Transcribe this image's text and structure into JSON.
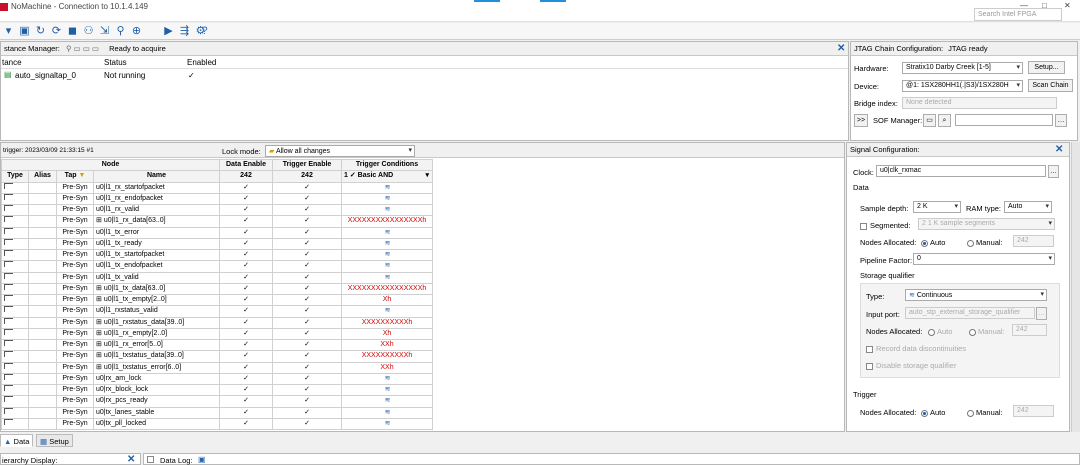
{
  "window": {
    "title": "NoMachine - Connection to 10.1.4.149",
    "search_placeholder": "Search Intel FPGA",
    "min": "—",
    "max": "□",
    "close": "✕"
  },
  "instance_manager": {
    "title": "stance Manager:",
    "status": "Ready to acquire",
    "columns": [
      "tance",
      "Status",
      "Enabled"
    ],
    "row": {
      "name": "auto_signaltap_0",
      "status": "Not running",
      "enabled": "✓"
    }
  },
  "jtag": {
    "title": "JTAG Chain Configuration:",
    "status": "JTAG ready",
    "hardware_label": "Hardware:",
    "hardware_value": "Stratix10 Darby Creek [1-5]",
    "setup_label": "Setup...",
    "device_label": "Device:",
    "device_value": "@1: 1SX280HH1(.|S3)/1SX280H",
    "scan_label": "Scan Chain",
    "bridge_label": "Bridge index:",
    "bridge_value": "None detected",
    "sof_button": ">>",
    "sof_label": "SOF Manager:"
  },
  "node_list": {
    "trigger_info": "trigger: 2023/03/09 21:33:15  #1",
    "lock_label": "Lock mode:",
    "lock_value": "Allow all changes",
    "group_node": "Node",
    "group_data": "Data Enable",
    "group_trigger": "Trigger Enable",
    "group_cond": "Trigger Conditions",
    "cols": [
      "Type",
      "Alias",
      "Tap",
      "Name"
    ],
    "data_count": "242",
    "trig_count": "242",
    "cond_value": "1 ✓ Basic AND",
    "rows": [
      {
        "tap": "Pre-Syn",
        "name": "u0|l1_rx_startofpacket",
        "exp": "",
        "cond": "≋",
        "red": false
      },
      {
        "tap": "Pre-Syn",
        "name": "u0|l1_rx_endofpacket",
        "exp": "",
        "cond": "≋",
        "red": false
      },
      {
        "tap": "Pre-Syn",
        "name": "u0|l1_rx_valid",
        "exp": "",
        "cond": "≋",
        "red": false
      },
      {
        "tap": "Pre-Syn",
        "name": "u0|l1_rx_data[63..0]",
        "exp": "⊞",
        "cond": "XXXXXXXXXXXXXXXXh",
        "red": true
      },
      {
        "tap": "Pre-Syn",
        "name": "u0|l1_tx_error",
        "exp": "",
        "cond": "≋",
        "red": false
      },
      {
        "tap": "Pre-Syn",
        "name": "u0|l1_tx_ready",
        "exp": "",
        "cond": "≋",
        "red": false
      },
      {
        "tap": "Pre-Syn",
        "name": "u0|l1_tx_startofpacket",
        "exp": "",
        "cond": "≋",
        "red": false
      },
      {
        "tap": "Pre-Syn",
        "name": "u0|l1_tx_endofpacket",
        "exp": "",
        "cond": "≋",
        "red": false
      },
      {
        "tap": "Pre-Syn",
        "name": "u0|l1_tx_valid",
        "exp": "",
        "cond": "≋",
        "red": false
      },
      {
        "tap": "Pre-Syn",
        "name": "u0|l1_tx_data[63..0]",
        "exp": "⊞",
        "cond": "XXXXXXXXXXXXXXXXh",
        "red": true
      },
      {
        "tap": "Pre-Syn",
        "name": "u0|l1_tx_empty[2..0]",
        "exp": "⊞",
        "cond": "Xh",
        "red": true
      },
      {
        "tap": "Pre-Syn",
        "name": "u0|l1_rxstatus_valid",
        "exp": "",
        "cond": "≋",
        "red": false
      },
      {
        "tap": "Pre-Syn",
        "name": "u0|l1_rxstatus_data[39..0]",
        "exp": "⊞",
        "cond": "XXXXXXXXXXh",
        "red": true
      },
      {
        "tap": "Pre-Syn",
        "name": "u0|l1_rx_empty[2..0]",
        "exp": "⊞",
        "cond": "Xh",
        "red": true
      },
      {
        "tap": "Pre-Syn",
        "name": "u0|l1_rx_error[5..0]",
        "exp": "⊞",
        "cond": "XXh",
        "red": true
      },
      {
        "tap": "Pre-Syn",
        "name": "u0|l1_txstatus_data[39..0]",
        "exp": "⊞",
        "cond": "XXXXXXXXXXh",
        "red": true
      },
      {
        "tap": "Pre-Syn",
        "name": "u0|l1_txstatus_error[6..0]",
        "exp": "⊞",
        "cond": "XXh",
        "red": true
      },
      {
        "tap": "Pre-Syn",
        "name": "u0|rx_am_lock",
        "exp": "",
        "cond": "≋",
        "red": false
      },
      {
        "tap": "Pre-Syn",
        "name": "u0|rx_block_lock",
        "exp": "",
        "cond": "≋",
        "red": false
      },
      {
        "tap": "Pre-Syn",
        "name": "u0|rx_pcs_ready",
        "exp": "",
        "cond": "≋",
        "red": false
      },
      {
        "tap": "Pre-Syn",
        "name": "u0|tx_lanes_stable",
        "exp": "",
        "cond": "≋",
        "red": false
      },
      {
        "tap": "Pre-Syn",
        "name": "u0|tx_pll_locked",
        "exp": "",
        "cond": "≋",
        "red": false
      }
    ],
    "check": "✓"
  },
  "signal_config": {
    "title": "Signal Configuration:",
    "clock_label": "Clock:",
    "clock_value": "u0|clk_rxmac",
    "data_section": "Data",
    "depth_label": "Sample depth:",
    "depth_value": "2 K",
    "ram_label": "RAM type:",
    "ram_value": "Auto",
    "segmented_label": "Segmented:",
    "segmented_value": "2  1 K sample segments",
    "nodes_alloc_label": "Nodes Allocated:",
    "auto_label": "Auto",
    "manual_label": "Manual:",
    "manual_value": "242",
    "pipeline_label": "Pipeline Factor:",
    "pipeline_value": "0",
    "storage_section": "Storage qualifier",
    "type_label": "Type:",
    "type_value": "Continuous",
    "input_port_label": "Input port:",
    "input_port_value": "auto_stp_external_storage_qualifier",
    "sq_nodes_label": "Nodes Allocated:",
    "sq_auto": "Auto",
    "sq_manual": "Manual:",
    "sq_manual_value": "242",
    "record_label": "Record data discontinuities",
    "disable_label": "Disable storage qualifier",
    "trigger_section": "Trigger",
    "trig_nodes_label": "Nodes Allocated:",
    "trig_auto": "Auto",
    "trig_manual": "Manual:",
    "trig_manual_value": "242"
  },
  "tabs": {
    "data": "Data",
    "setup": "Setup"
  },
  "bottom": {
    "hierarchy": "ierarchy Display:",
    "datalog": "Data Log:"
  }
}
